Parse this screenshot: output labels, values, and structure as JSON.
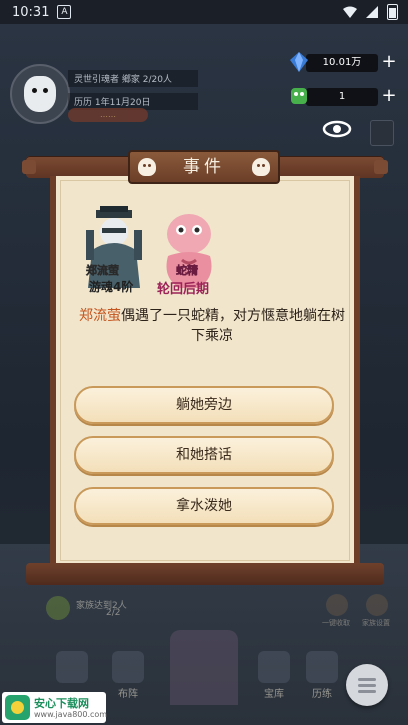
{
  "status_bar": {
    "time": "10:31",
    "app_icon_letter": "A"
  },
  "player": {
    "line1": "灵世引魂者 鄉家 2/20人",
    "line2": "历历 1年11月20日",
    "badge": "……"
  },
  "resources": [
    {
      "name": "spirit-stone",
      "value": "10.01万",
      "color": "#3a7bd5"
    },
    {
      "name": "jade",
      "value": "1",
      "color": "#47b04b"
    }
  ],
  "dialog": {
    "title": "事件",
    "characters": [
      {
        "top_label": "郑流萤",
        "bottom_label": "游魂4阶",
        "bottom_color": "#1f1f1f"
      },
      {
        "top_label": "蛇精",
        "bottom_label": "轮回后期",
        "bottom_color": "#9b2257"
      }
    ],
    "event_name": "郑流萤",
    "event_text": "偶遇了一只蛇精，对方惬意地躺在树下乘凉",
    "choices": [
      "躺她旁边",
      "和她搭话",
      "拿水泼她"
    ]
  },
  "background": {
    "family_text": "家族达到2人",
    "family_sub": "2/2",
    "right_labels": [
      "一键收取",
      "家族设置"
    ],
    "nav_labels": [
      "",
      "布阵",
      "",
      "宝库",
      "历练"
    ]
  },
  "watermark": {
    "title": "安心下载网",
    "url": "www.java800.com"
  },
  "colors": {
    "accent_name": "#c4551e",
    "panel": "#f1e5cc",
    "frame": "#6d3d28"
  }
}
